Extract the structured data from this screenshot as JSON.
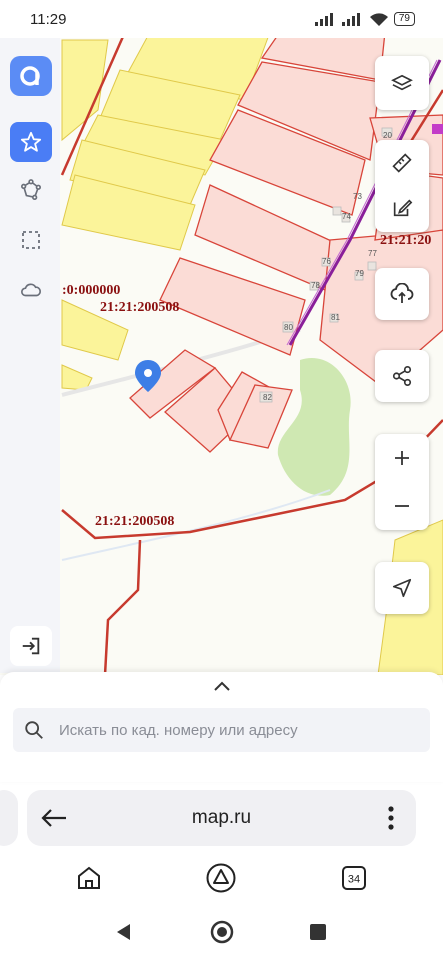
{
  "status_bar": {
    "time": "11:29",
    "battery": "79"
  },
  "map": {
    "cadastral_labels": [
      "21:21:200508",
      "21:21:200508",
      "21:21:20",
      ":0:000000"
    ],
    "building_numbers": [
      "73",
      "74",
      "76",
      "78",
      "77",
      "79",
      "80",
      "81",
      "82",
      "20"
    ]
  },
  "sidebar": {
    "items": [
      {
        "icon": "app-logo-icon"
      },
      {
        "icon": "star-icon"
      },
      {
        "icon": "polygon-tool-icon"
      },
      {
        "icon": "selection-area-icon"
      },
      {
        "icon": "cloud-icon"
      },
      {
        "icon": "logout-icon"
      }
    ]
  },
  "map_controls": [
    "layers-icon",
    "ruler-icon",
    "edit-icon",
    "upload-icon",
    "share-icon",
    "zoom-in-icon",
    "zoom-out-icon",
    "location-arrow-icon"
  ],
  "search": {
    "placeholder": "Искать по кад. номеру или адресу"
  },
  "browser": {
    "url": "map.ru",
    "tabs_count": "34"
  },
  "colors": {
    "accent": "#4a7df5",
    "parcel_border": "#d8453a",
    "parcel_fill": "#fbdcd6",
    "zone_fill": "#fbf49a",
    "road_red": "#c73a2e",
    "power_line": "#8a1f9a",
    "park": "#cfe8b2"
  }
}
